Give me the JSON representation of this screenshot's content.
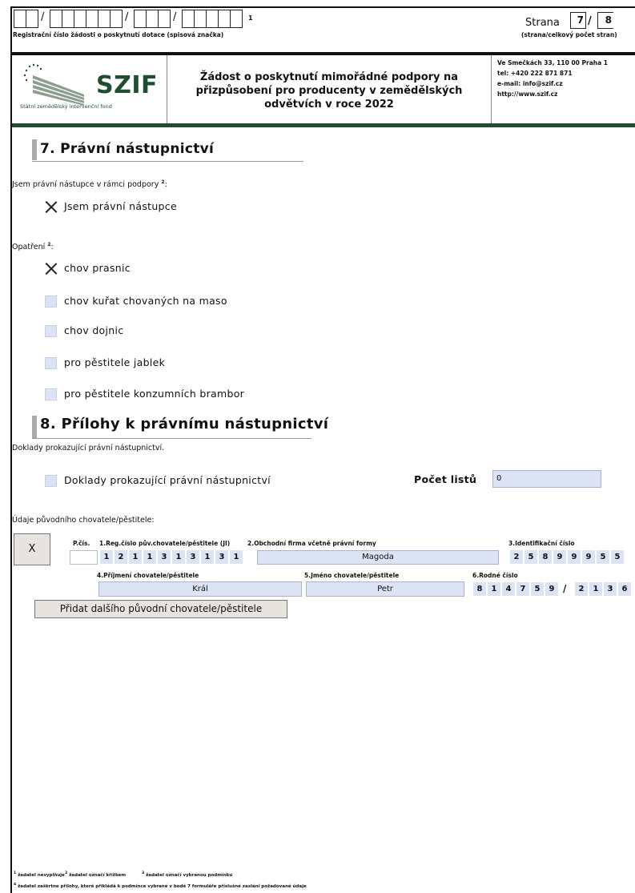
{
  "header": {
    "reg_label": "Registrační číslo žádosti o poskytnutí dotace (spisová značka)",
    "reg_sup": "1",
    "page_word": "Strana",
    "page_current": "7",
    "page_slash": "/",
    "page_total": "8",
    "page_sub": "(strana/celkový počet stran)"
  },
  "logo": {
    "text": "SZIF",
    "subtitle": "Státní zemědělský intervenční fond"
  },
  "form_title": {
    "line1": "Žádost o poskytnutí mimořádné podpory na",
    "line2": "přizpůsobení pro producenty v zemědělských",
    "line3": "odvětvích v roce 2022"
  },
  "contact": {
    "address": "Ve Smečkách 33, 110 00 Praha 1",
    "tel": "tel: +420 222 871 871",
    "email": "e-mail: info@szif.cz",
    "web": "http://www.szif.cz"
  },
  "section7": {
    "title": "7. Právní nástupnictví",
    "q1_label": "Jsem právní nástupce v rámci podpory",
    "q1_sup": "2",
    "q1_colon": ":",
    "q1_option": {
      "label": "Jsem právní nástupce",
      "checked": true
    },
    "q2_label": "Opatření",
    "q2_sup": "2",
    "q2_colon": ":",
    "options": [
      {
        "label": "chov prasnic",
        "checked": true
      },
      {
        "label": "chov kuřat chovaných na maso",
        "checked": false
      },
      {
        "label": "chov dojnic",
        "checked": false
      },
      {
        "label": "pro pěstitele jablek",
        "checked": false
      },
      {
        "label": "pro pěstitele konzumních brambor",
        "checked": false
      }
    ]
  },
  "section8": {
    "title": "8. Přílohy k právnímu nástupnictví",
    "subtitle": "Doklady prokazující právní nástupnictví.",
    "doc_option": {
      "label": "Doklady prokazující právní nástupnictví",
      "checked": false
    },
    "count_label": "Počet listů",
    "count_value": "0"
  },
  "original_holder": {
    "heading": "Údaje původního chovatele/pěstitele:",
    "remove_button": "X",
    "col_pcis": "P.čís.",
    "col_reg": "1.Reg.číslo pův.chovatele/pěstitele (JI)",
    "col_firm": "2.Obchodní firma včetně právní formy",
    "col_ic": "3.Identifikační číslo",
    "col_surname": "4.Příjmení chovatele/pěstitele",
    "col_name": "5.Jméno chovatele/pěstitele",
    "col_rc": "6.Rodné číslo",
    "row": {
      "pcis": "",
      "reg_digits": [
        "1",
        "2",
        "1",
        "1",
        "3",
        "1",
        "3",
        "1",
        "3",
        "1"
      ],
      "firm": "Magoda",
      "ic_digits": [
        "2",
        "5",
        "8",
        "9",
        "9",
        "9",
        "5",
        "5"
      ],
      "surname": "Král",
      "name": "Petr",
      "rc_left": [
        "8",
        "1",
        "4",
        "7",
        "5",
        "9"
      ],
      "rc_slash": "/",
      "rc_right": [
        "2",
        "1",
        "3",
        "6"
      ]
    },
    "add_button": "Přidat dalšího původní chovatele/pěstitele"
  },
  "footnotes": {
    "n1": "1",
    "t1": "žadatel nevyplňuje",
    "n2": "2",
    "t2": "žadatel označí křížkem",
    "n3": "3",
    "t3": "žadatel označí vybranou podmínku",
    "n4": "4",
    "t4": "žadatel zaškrtne přílohy, které přikládá k podmínce vybrané v bodě 7 formuláře příslušné zaslání požadované údaje"
  },
  "colors": {
    "field_bg": "#dbe3f5",
    "brand_green": "#1e4e2e",
    "checkbox_bg": "#dbe3f5"
  }
}
